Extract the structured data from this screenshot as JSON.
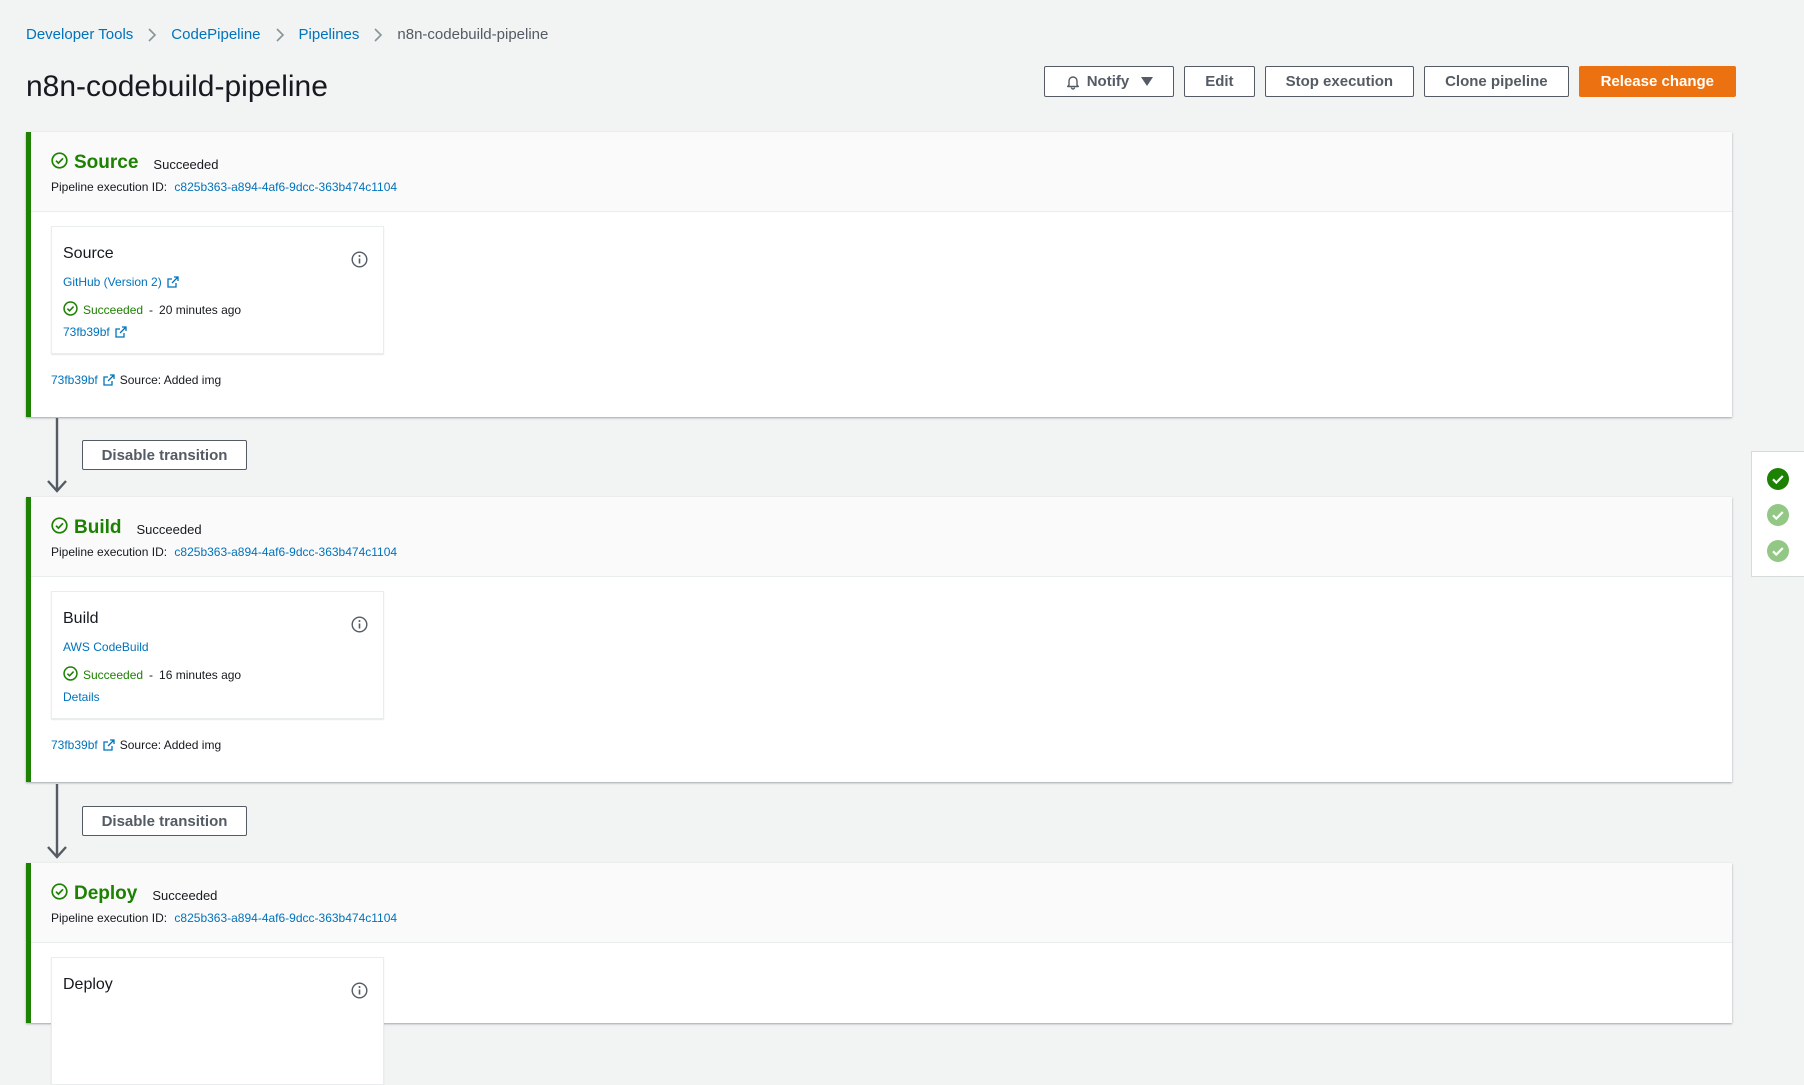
{
  "breadcrumb": [
    {
      "label": "Developer Tools"
    },
    {
      "label": "CodePipeline"
    },
    {
      "label": "Pipelines"
    },
    {
      "label": "n8n-codebuild-pipeline"
    }
  ],
  "page": {
    "title": "n8n-codebuild-pipeline"
  },
  "actions": {
    "notify": "Notify",
    "edit": "Edit",
    "stop": "Stop execution",
    "clone": "Clone pipeline",
    "release": "Release change"
  },
  "transitions": {
    "disable_label": "Disable transition"
  },
  "stages": [
    {
      "name": "Source",
      "status": "Succeeded",
      "exec_label": "Pipeline execution ID:",
      "exec_id": "c825b363-a894-4af6-9dcc-363b474c1104",
      "action": {
        "name": "Source",
        "provider": "GitHub (Version 2)",
        "status": "Succeeded",
        "time": "20 minutes ago",
        "link": "73fb39bf"
      },
      "revision": {
        "id": "73fb39bf",
        "desc": "Source: Added img"
      }
    },
    {
      "name": "Build",
      "status": "Succeeded",
      "exec_label": "Pipeline execution ID:",
      "exec_id": "c825b363-a894-4af6-9dcc-363b474c1104",
      "action": {
        "name": "Build",
        "provider": "AWS CodeBuild",
        "status": "Succeeded",
        "time": "16 minutes ago",
        "link": "Details"
      },
      "revision": {
        "id": "73fb39bf",
        "desc": "Source: Added img"
      }
    },
    {
      "name": "Deploy",
      "status": "Succeeded",
      "exec_label": "Pipeline execution ID:",
      "exec_id": "c825b363-a894-4af6-9dcc-363b474c1104",
      "action": {
        "name": "Deploy"
      }
    }
  ],
  "colors": {
    "success": "#1d8102",
    "link": "#0073bb",
    "primary": "#ec7211",
    "background": "#f2f3f3"
  },
  "icons": {
    "stage_status": "check-circle-icon",
    "info": "info-circle-icon",
    "external": "external-link-icon",
    "notify": "bell-icon",
    "dropdown": "caret-down-icon"
  }
}
